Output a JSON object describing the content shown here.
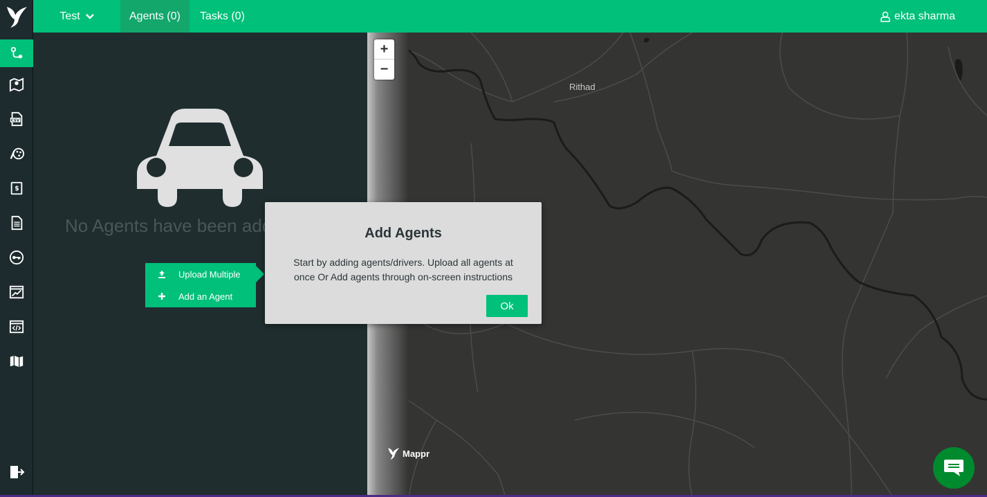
{
  "topbar": {
    "project": "Test",
    "tabs": [
      {
        "label": "Agents (0)"
      },
      {
        "label": "Tasks (0)"
      }
    ],
    "user": "ekta sharma"
  },
  "sidebar": {
    "items": [
      {
        "icon": "route-pin-icon",
        "active": true
      },
      {
        "icon": "map-pin-icon"
      },
      {
        "icon": "csv-file-icon"
      },
      {
        "icon": "palette-icon"
      },
      {
        "icon": "billing-book-icon"
      },
      {
        "icon": "document-icon"
      },
      {
        "icon": "key-icon"
      },
      {
        "icon": "analytics-chart-icon"
      },
      {
        "icon": "code-window-icon"
      },
      {
        "icon": "map-icon"
      }
    ],
    "logout_icon": "logout-icon"
  },
  "panel": {
    "empty_message": "No Agents have been added yet.",
    "menu": {
      "upload_multiple": "Upload Multiple",
      "add_agent": "Add an Agent"
    }
  },
  "map": {
    "zoom_in": "+",
    "zoom_out": "−",
    "place_label": "Rithad",
    "brand": "Mappr"
  },
  "dialog": {
    "title": "Add Agents",
    "body": "Start by adding agents/drivers. Upload all agents at once Or Add agents through on-screen instructions",
    "ok_label": "Ok"
  },
  "colors": {
    "accent": "#00c07a",
    "panel_bg": "#1f2d2f",
    "map_bg": "#343433",
    "chat_bg": "#008a2e"
  }
}
